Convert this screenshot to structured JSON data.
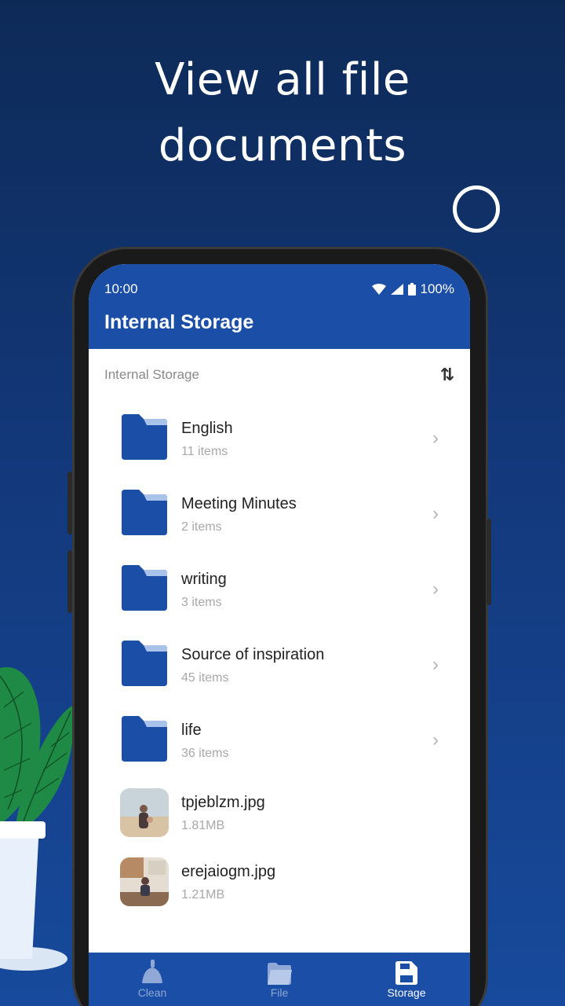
{
  "headline": {
    "line1": "View all file",
    "line2": "documents"
  },
  "statusbar": {
    "time": "10:00",
    "battery": "100%"
  },
  "appbar": {
    "title": "Internal Storage"
  },
  "path": {
    "label": "Internal Storage",
    "sort_icon": "sort-icon"
  },
  "items": [
    {
      "type": "folder",
      "name": "English",
      "sub": "11 items"
    },
    {
      "type": "folder",
      "name": "Meeting Minutes",
      "sub": "2 items"
    },
    {
      "type": "folder",
      "name": "writing",
      "sub": "3 items"
    },
    {
      "type": "folder",
      "name": "Source of inspiration",
      "sub": "45 items"
    },
    {
      "type": "folder",
      "name": "life",
      "sub": "36 items"
    },
    {
      "type": "file",
      "name": "tpjeblzm.jpg",
      "sub": "1.81MB"
    },
    {
      "type": "file",
      "name": "erejaiogm.jpg",
      "sub": "1.21MB"
    }
  ],
  "nav": [
    {
      "label": "Clean",
      "icon": "broom-icon",
      "active": false
    },
    {
      "label": "File",
      "icon": "folder-icon",
      "active": false
    },
    {
      "label": "Storage",
      "icon": "sd-card-icon",
      "active": true
    }
  ],
  "colors": {
    "brand": "#1b4ea6",
    "folder": "#1b4ea6",
    "background_top": "#0d2a57"
  }
}
